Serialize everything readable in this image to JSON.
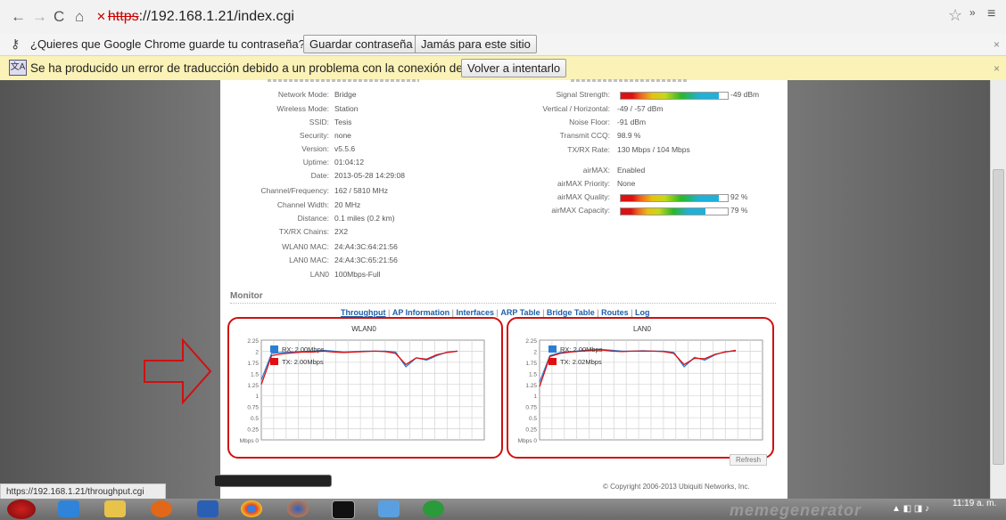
{
  "browser": {
    "url_scheme": "https",
    "url_rest": "://192.168.1.21/index.cgi",
    "password_prompt": "¿Quieres que Google Chrome guarde tu contraseña?",
    "save_password_btn": "Guardar contraseña",
    "never_btn": "Jamás para este sitio",
    "translate_error": "Se ha producido un error de traducción debido a un problema con la conexión de red.",
    "retry_btn": "Volver a intentarlo",
    "close_glyph": "×",
    "status_url": "https://192.168.1.21/throughput.cgi"
  },
  "status_left": [
    {
      "label": "Network Mode:",
      "value": "Bridge"
    },
    {
      "label": "Wireless Mode:",
      "value": "Station"
    },
    {
      "label": "SSID:",
      "value": "Tesis"
    },
    {
      "label": "Security:",
      "value": "none"
    },
    {
      "label": "Version:",
      "value": "v5.5.6"
    },
    {
      "label": "Uptime:",
      "value": "01:04:12"
    },
    {
      "label": "Date:",
      "value": "2013-05-28 14:29:08"
    },
    {
      "label": "Channel/Frequency:",
      "value": "162 / 5810 MHz"
    },
    {
      "label": "Channel Width:",
      "value": "20 MHz"
    },
    {
      "label": "Distance:",
      "value": "0.1 miles (0.2 km)"
    },
    {
      "label": "TX/RX Chains:",
      "value": "2X2"
    },
    {
      "label": "WLAN0 MAC:",
      "value": "24:A4:3C:64:21:56"
    },
    {
      "label": "LAN0 MAC:",
      "value": "24:A4:3C:65:21:56"
    },
    {
      "label": "LAN0",
      "value": "100Mbps-Full"
    }
  ],
  "status_right": [
    {
      "label": "Signal Strength:",
      "value": "-49 dBm",
      "meter": 0.92
    },
    {
      "label": "Vertical / Horizontal:",
      "value": "-49 / -57 dBm"
    },
    {
      "label": "Noise Floor:",
      "value": "-91 dBm"
    },
    {
      "label": "Transmit CCQ:",
      "value": "98.9 %"
    },
    {
      "label": "TX/RX Rate:",
      "value": "130 Mbps / 104 Mbps"
    },
    {
      "label": "airMAX:",
      "value": "Enabled"
    },
    {
      "label": "airMAX Priority:",
      "value": "None"
    },
    {
      "label": "airMAX Quality:",
      "value": "92 %",
      "meter": 0.92
    },
    {
      "label": "airMAX Capacity:",
      "value": "79 %",
      "meter": 0.79
    }
  ],
  "monitor": {
    "title": "Monitor",
    "tabs": [
      "Throughput",
      "AP Information",
      "Interfaces",
      "ARP Table",
      "Bridge Table",
      "Routes",
      "Log"
    ],
    "tab_sep": "|",
    "refresh": "Refresh",
    "copyright": "© Copyright 2006-2013 Ubiquiti Networks, Inc."
  },
  "chart_data": [
    {
      "type": "line",
      "title": "WLAN0",
      "ylabel": "Mbps",
      "ylim": [
        0,
        2.25
      ],
      "yticks": [
        "2.25",
        "2",
        "1.75",
        "1.5",
        "1.25",
        "1",
        "0.75",
        "0.5",
        "0.25",
        "Mbps 0"
      ],
      "x": [
        0,
        1,
        2,
        3,
        4,
        5,
        6,
        7,
        8,
        9,
        10,
        11,
        12,
        13,
        14,
        15,
        16,
        17,
        18,
        19
      ],
      "series": [
        {
          "name": "RX: 2.00Mbps",
          "color": "#2a7fd4",
          "values": [
            1.35,
            1.95,
            1.97,
            1.98,
            1.99,
            2.0,
            2.02,
            2.0,
            1.98,
            1.99,
            2.0,
            2.0,
            2.0,
            1.98,
            1.65,
            1.85,
            1.8,
            1.9,
            1.98,
            2.0
          ]
        },
        {
          "name": "TX: 2.00Mbps",
          "color": "#e01010",
          "values": [
            1.25,
            1.9,
            1.94,
            1.96,
            1.98,
            1.98,
            2.0,
            1.98,
            1.97,
            1.98,
            1.99,
            2.0,
            1.99,
            1.95,
            1.7,
            1.85,
            1.82,
            1.92,
            1.97,
            2.0
          ]
        }
      ]
    },
    {
      "type": "line",
      "title": "LAN0",
      "ylabel": "Mbps",
      "ylim": [
        0,
        2.25
      ],
      "yticks": [
        "2.25",
        "2",
        "1.75",
        "1.5",
        "1.25",
        "1",
        "0.75",
        "0.5",
        "0.25",
        "Mbps 0"
      ],
      "x": [
        0,
        1,
        2,
        3,
        4,
        5,
        6,
        7,
        8,
        9,
        10,
        11,
        12,
        13,
        14,
        15,
        16,
        17,
        18,
        19
      ],
      "series": [
        {
          "name": "RX: 2.00Mbps",
          "color": "#2a7fd4",
          "values": [
            1.3,
            1.9,
            1.97,
            1.99,
            2.01,
            2.03,
            2.04,
            2.02,
            2.0,
            2.0,
            2.01,
            2.0,
            2.0,
            1.97,
            1.65,
            1.86,
            1.8,
            1.92,
            1.99,
            2.0
          ]
        },
        {
          "name": "TX: 2.02Mbps",
          "color": "#e01010",
          "values": [
            1.2,
            1.88,
            1.95,
            1.98,
            2.0,
            2.02,
            2.03,
            2.0,
            1.99,
            2.0,
            2.0,
            2.0,
            1.99,
            1.95,
            1.7,
            1.84,
            1.83,
            1.93,
            1.98,
            2.02
          ]
        }
      ]
    }
  ],
  "taskbar": {
    "clock_time": "11:19 a. m.",
    "watermark": "memegenerator"
  }
}
